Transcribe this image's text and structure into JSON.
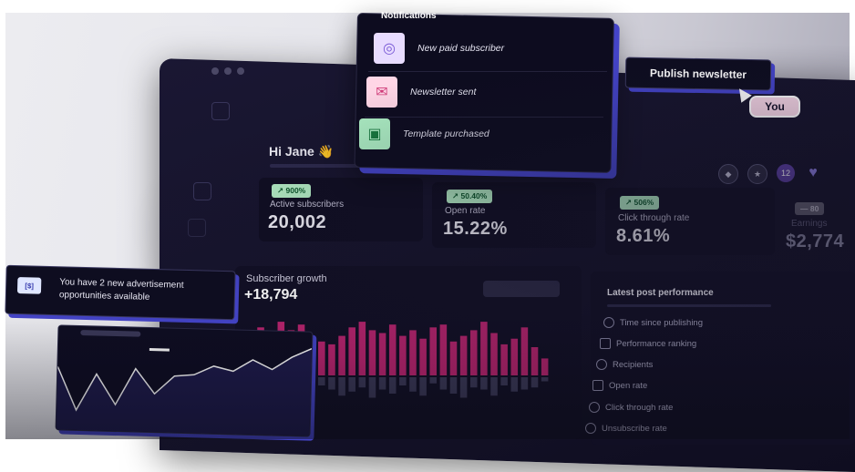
{
  "notifications": {
    "title": "Notifications",
    "items": [
      {
        "label": "New paid subscriber",
        "icon": "user-icon",
        "color": "#e8dcff"
      },
      {
        "label": "Newsletter sent",
        "icon": "mail-icon",
        "color": "#ffd6e6"
      },
      {
        "label": "Template purchased",
        "icon": "box-icon",
        "color": "#aef0c5"
      }
    ]
  },
  "publish_label": "Publish newsletter",
  "cursor_label": "You",
  "greeting": "Hi Jane 👋",
  "stats": [
    {
      "badge": "↗ 900%",
      "label": "Active subscribers",
      "value": "20,002"
    },
    {
      "badge": "↗ 50.40%",
      "label": "Open rate",
      "value": "15.22%"
    },
    {
      "badge": "↗ 506%",
      "label": "Click through rate",
      "value": "8.61%"
    },
    {
      "badge": "— 80",
      "label": "Earnings",
      "value": "$2,774"
    }
  ],
  "growth": {
    "title": "Subscriber growth",
    "value": "+18,794"
  },
  "performance": {
    "title": "Latest post performance",
    "items": [
      "Time since publishing",
      "Performance ranking",
      "Recipients",
      "Open rate",
      "Click through rate",
      "Unsubscribe rate"
    ]
  },
  "ad": {
    "icon_text": "[$]",
    "text": "You have 2 new advertisement opportunities available"
  },
  "colors": {
    "accent": "#4444c8",
    "bar": "#b8246e",
    "bar_low": "#3a3856",
    "board": "#141228"
  },
  "bars": {
    "up": [
      0.45,
      0.55,
      0.85,
      0.75,
      0.95,
      0.8,
      0.9,
      0.7,
      0.6,
      0.55,
      0.7,
      0.85,
      0.95,
      0.8,
      0.75,
      0.9,
      0.7,
      0.8,
      0.65,
      0.85,
      0.9,
      0.6,
      0.7,
      0.8,
      0.95,
      0.75,
      0.55,
      0.65,
      0.85,
      0.5,
      0.3
    ],
    "down": [
      0.2,
      0.3,
      0.1,
      0.35,
      0.4,
      0.15,
      0.3,
      0.5,
      0.2,
      0.3,
      0.45,
      0.35,
      0.25,
      0.5,
      0.3,
      0.4,
      0.2,
      0.35,
      0.45,
      0.15,
      0.3,
      0.4,
      0.5,
      0.25,
      0.3,
      0.45,
      0.2,
      0.35,
      0.3,
      0.25,
      0.1
    ]
  },
  "mini_chart": [
    0.35,
    0.82,
    0.42,
    0.75,
    0.35,
    0.62,
    0.42,
    0.4,
    0.3,
    0.35,
    0.22,
    0.32,
    0.18,
    0.08
  ]
}
